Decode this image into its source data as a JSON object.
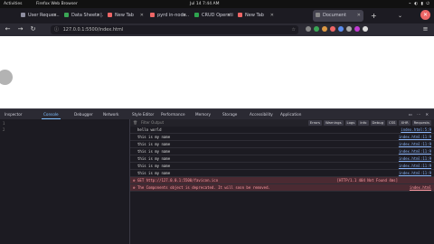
{
  "system_bar": {
    "activities": "Activities",
    "app": "Firefox Web Browser",
    "clock": "Jul 14  7:44 AM",
    "tray": "⌁ ◐ ▮ ⏻"
  },
  "tabs": [
    {
      "label": "User Reques…",
      "fav": "#8e8ea0",
      "active": false
    },
    {
      "label": "Data Sheets |…",
      "fav": "#3aa655",
      "active": false
    },
    {
      "label": "New Tab",
      "fav": "#e66",
      "active": false
    },
    {
      "label": "pyrd in-node…",
      "fav": "#e66",
      "active": false
    },
    {
      "label": "CRUD Operati…",
      "fav": "#2ea44f",
      "active": false
    },
    {
      "label": "New Tab",
      "fav": "#e66",
      "active": false
    },
    {
      "label": "Document",
      "fav": "#888",
      "active": true
    }
  ],
  "toolbar": {
    "url": "127.0.0.1:5500/index.html",
    "new_tab": "+",
    "tab_list": "⌄",
    "close": "✕"
  },
  "devtools": {
    "tabs": [
      "Inspector",
      "Console",
      "Debugger",
      "Network",
      "Style Editor",
      "Performance",
      "Memory",
      "Storage",
      "Accessibility",
      "Application"
    ],
    "active_tab": "Console",
    "icons": "▭ ⋯ ✕"
  },
  "console": {
    "filter_placeholder": "Filter Output",
    "filters": [
      "Errors",
      "Warnings",
      "Logs",
      "Info",
      "Debug",
      "CSS",
      "XHR",
      "Requests"
    ],
    "logs": [
      {
        "msg": "hello world",
        "src": "index.html:5:9",
        "type": "log"
      },
      {
        "msg": "this is my name",
        "src": "index.html:11:9",
        "type": "log"
      },
      {
        "msg": "this is my name",
        "src": "index.html:11:9",
        "type": "log"
      },
      {
        "msg": "this is my name",
        "src": "index.html:11:9",
        "type": "log"
      },
      {
        "msg": "this is my name",
        "src": "index.html:11:9",
        "type": "log"
      },
      {
        "msg": "this is my name",
        "src": "index.html:11:9",
        "type": "log"
      },
      {
        "msg": "this is my name",
        "src": "index.html:11:9",
        "type": "log"
      },
      {
        "msg": "GET http://127.0.0.1:5500/favicon.ico",
        "src": "",
        "status": "[HTTP/1.1 404 Not Found 4ms]",
        "type": "error"
      },
      {
        "msg": "The Components object is deprecated. It will soon be removed.",
        "src": "index.html",
        "type": "error"
      }
    ]
  },
  "editor_lines": [
    "1",
    "2"
  ]
}
